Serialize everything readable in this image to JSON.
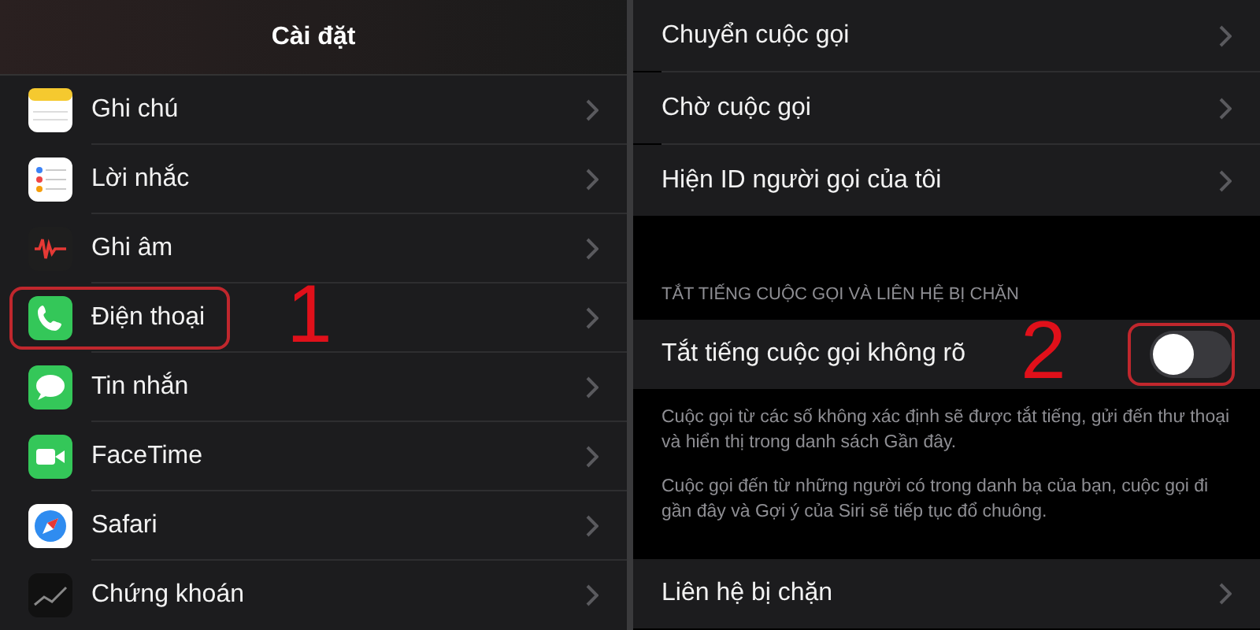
{
  "left_screen": {
    "title": "Cài đặt",
    "items": [
      {
        "label": "Ghi chú",
        "kind": "notes",
        "highlighted": false
      },
      {
        "label": "Lời nhắc",
        "kind": "reminders",
        "highlighted": false
      },
      {
        "label": "Ghi âm",
        "kind": "voice",
        "highlighted": false
      },
      {
        "label": "Điện thoại",
        "kind": "phone",
        "highlighted": true,
        "annotation": "1"
      },
      {
        "label": "Tin nhắn",
        "kind": "messages",
        "highlighted": false
      },
      {
        "label": "FaceTime",
        "kind": "video",
        "highlighted": false
      },
      {
        "label": "Safari",
        "kind": "compass",
        "highlighted": false
      },
      {
        "label": "Chứng khoán",
        "kind": "stocks",
        "highlighted": false
      }
    ]
  },
  "right_screen": {
    "items": [
      {
        "label": "Chuyển cuộc gọi"
      },
      {
        "label": "Chờ cuộc gọi"
      },
      {
        "label": "Hiện ID người gọi của tôi"
      }
    ],
    "section_header": "TẮT TIẾNG CUỘC GỌI VÀ LIÊN HỆ BỊ CHẶN",
    "toggle_row": {
      "label": "Tắt tiếng cuộc gọi không rõ",
      "on": false,
      "highlighted": true,
      "annotation": "2"
    },
    "footer_notes": [
      "Cuộc gọi từ các số không xác định sẽ được tắt tiếng, gửi đến thư thoại và hiển thị trong danh sách Gần đây.",
      "Cuộc gọi đến từ những người có trong danh bạ của bạn, cuộc gọi đi gần đây và Gợi ý của Siri sẽ tiếp tục đổ chuông."
    ],
    "bottom_items": [
      {
        "label": "Liên hệ bị chặn"
      }
    ]
  }
}
